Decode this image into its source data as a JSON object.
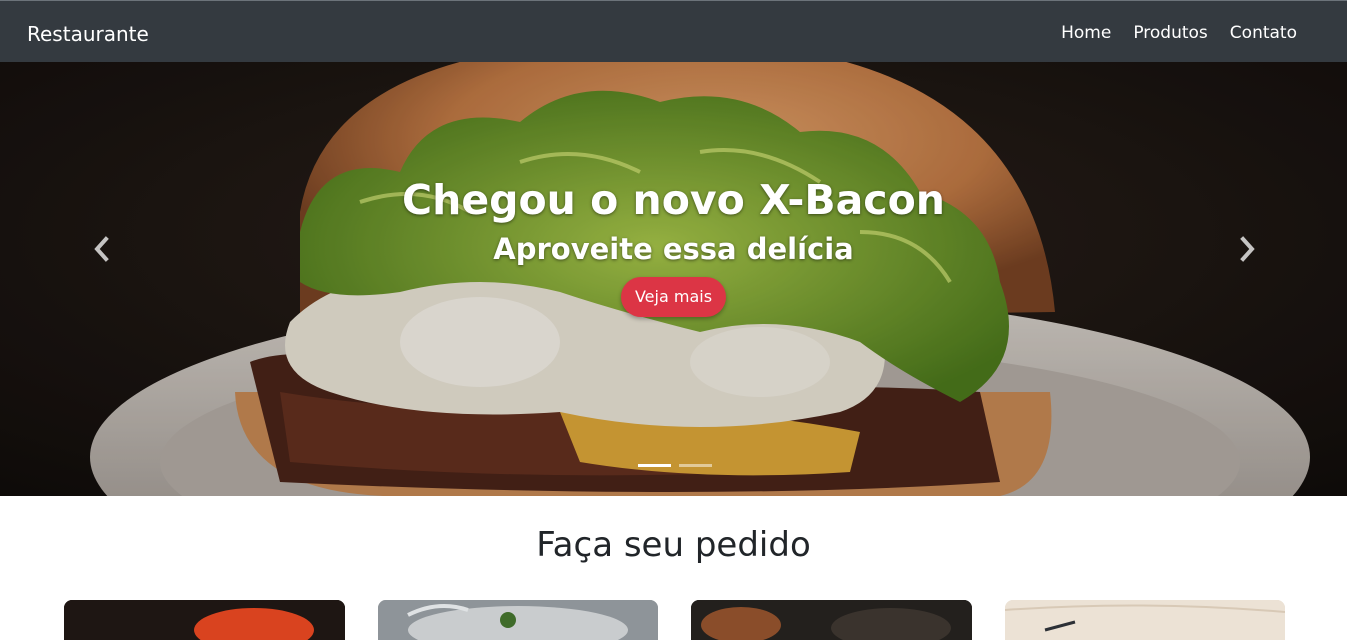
{
  "navbar": {
    "brand": "Restaurante",
    "links": [
      "Home",
      "Produtos",
      "Contato"
    ],
    "background": "#343a40"
  },
  "carousel": {
    "title": "Chegou o novo X-Bacon",
    "subtitle": "Aproveite essa delícia",
    "button": "Veja mais",
    "button_color": "#dc3545",
    "prev_icon": "chevron-left-icon",
    "next_icon": "chevron-right-icon",
    "slide_count": 2,
    "active_slide": 1
  },
  "orders": {
    "title": "Faça seu pedido",
    "cards": [
      "card-1",
      "card-2",
      "card-3",
      "card-4"
    ]
  }
}
